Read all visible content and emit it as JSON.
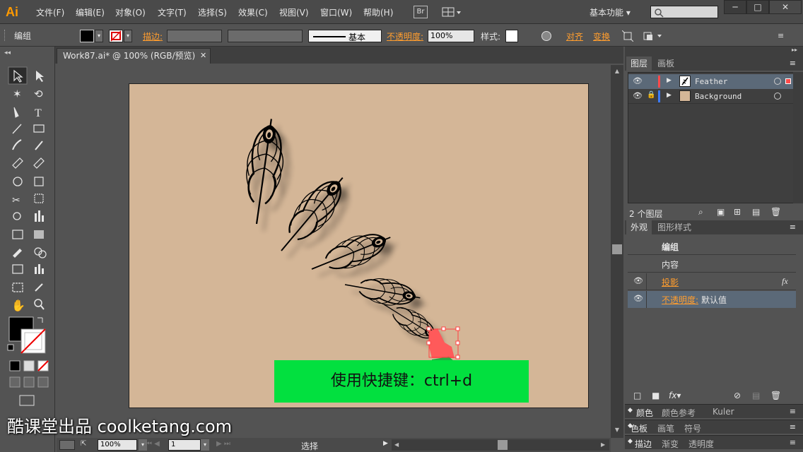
{
  "app": {
    "logo": "Ai",
    "workspace": "基本功能"
  },
  "menu": [
    "文件(F)",
    "编辑(E)",
    "对象(O)",
    "文字(T)",
    "选择(S)",
    "效果(C)",
    "视图(V)",
    "窗口(W)",
    "帮助(H)"
  ],
  "menu_icons": {
    "bridge": "Br",
    "arrange": "arrange-documents-icon"
  },
  "window_buttons": [
    "─",
    "□",
    "✕"
  ],
  "control": {
    "selection_label": "编组",
    "stroke_label": "描边:",
    "stroke_profile": "基本",
    "opacity_label": "不透明度:",
    "opacity_value": "100%",
    "style_label": "样式:",
    "align_label": "对齐",
    "transform_label": "变换"
  },
  "document": {
    "tab_title": "Work87.ai* @ 100% (RGB/预览)"
  },
  "banner": {
    "text": "使用快捷键：ctrl+d",
    "color": "#02e03f"
  },
  "status": {
    "zoom": "100%",
    "page": "1",
    "mode": "选择"
  },
  "layers_panel": {
    "tabs": [
      "图层",
      "画板"
    ],
    "layers": [
      {
        "name": "Feather",
        "color": "#ff4a4a",
        "locked": false,
        "visible": true
      },
      {
        "name": "Background",
        "color": "#3a7bff",
        "locked": true,
        "visible": true
      }
    ],
    "count": "2 个图层"
  },
  "appearance_panel": {
    "tabs": [
      "外观",
      "图形样式"
    ],
    "title": "编组",
    "rows": [
      {
        "label": "内容",
        "plain": true
      },
      {
        "label": "投影",
        "orange": true,
        "fx": "fx"
      },
      {
        "label": "不透明度:",
        "value": "默认值",
        "orange": true,
        "selected": true
      }
    ]
  },
  "collapsed_panels": [
    [
      "颜色",
      "颜色参考",
      "Kuler"
    ],
    [
      "色板",
      "画笔",
      "符号"
    ],
    [
      "描边",
      "渐变",
      "透明度"
    ]
  ],
  "watermark": "酷课堂出品 coolketang.com"
}
